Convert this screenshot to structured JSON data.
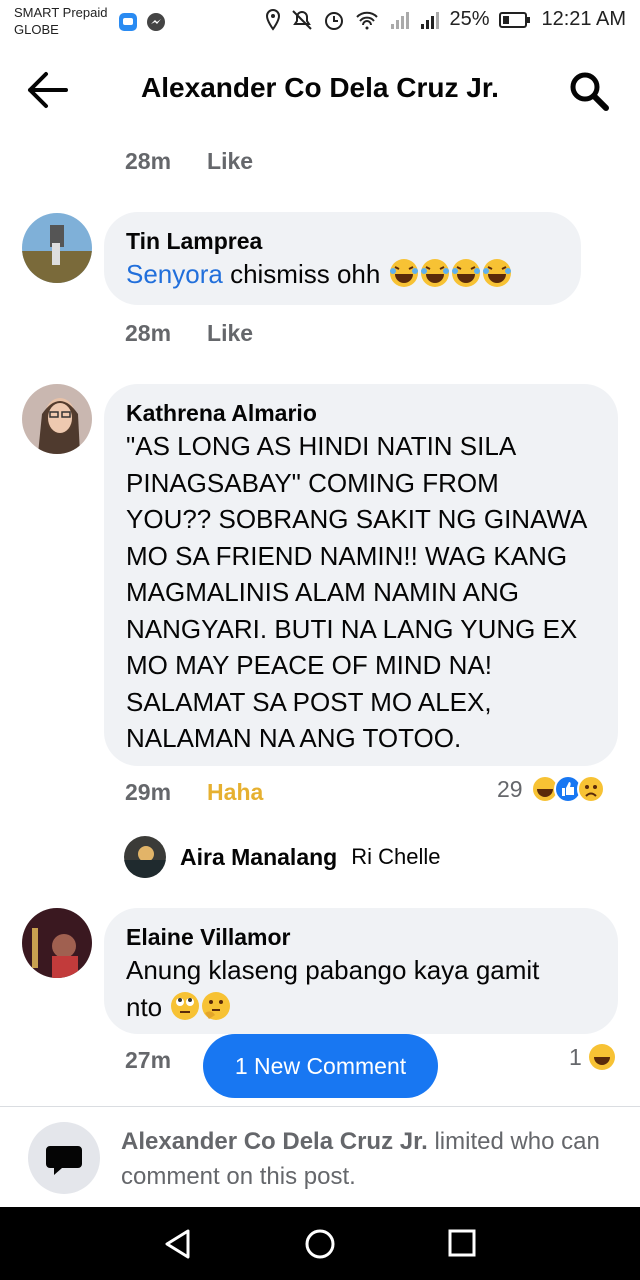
{
  "status_bar": {
    "carrier1": "SMART Prepaid",
    "carrier2": "GLOBE",
    "battery": "25%",
    "time": "12:21 AM"
  },
  "header": {
    "title": "Alexander Co Dela Cruz Jr."
  },
  "top_meta": {
    "time": "28m",
    "like": "Like"
  },
  "comments": [
    {
      "author": "Tin Lamprea",
      "mention": "Senyora",
      "text": " chismiss ohh",
      "time": "28m",
      "action": "Like"
    },
    {
      "author": "Kathrena Almario",
      "lines": [
        "\"AS LONG AS HINDI NATIN SILA",
        "PINAGSABAY\" COMING FROM",
        "YOU?? SOBRANG SAKIT NG GINAWA",
        "MO SA FRIEND NAMIN!! WAG KANG",
        "MAGMALINIS ALAM NAMIN ANG",
        "NANGYARI. BUTI NA LANG YUNG EX",
        "MO MAY PEACE OF MIND NA!",
        "SALAMAT SA POST MO ALEX,",
        "NALAMAN NA ANG TOTOO."
      ],
      "time": "29m",
      "action": "Haha",
      "reaction_count": "29"
    },
    {
      "author": "Elaine Villamor",
      "lines": [
        "Anung klaseng pabango kaya gamit",
        "nto"
      ],
      "time": "27m",
      "reaction_count": "1"
    }
  ],
  "reply": {
    "author": "Aira Manalang",
    "text": "Ri Chelle"
  },
  "new_comment_button": "1 New Comment",
  "limit_notice": {
    "name": "Alexander Co Dela Cruz Jr.",
    "text": " limited who can comment on this post."
  },
  "colors": {
    "accent": "#1877f2",
    "mention": "#216fdb",
    "haha": "#e6b030",
    "bubble": "#f0f2f5"
  },
  "icons": [
    "back-arrow-icon",
    "search-icon",
    "speech-bubble-icon",
    "nav-back-icon",
    "nav-home-icon",
    "nav-recents-icon"
  ]
}
